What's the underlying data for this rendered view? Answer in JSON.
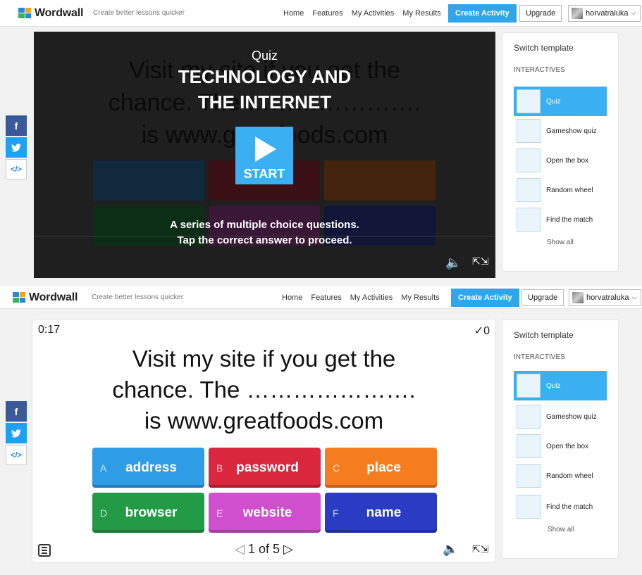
{
  "nav": {
    "logo": "Wordwall",
    "tagline": "Create better lessons quicker",
    "links": [
      "Home",
      "Features",
      "My Activities",
      "My Results"
    ],
    "create": "Create Activity",
    "upgrade": "Upgrade",
    "user": "horvatraluka"
  },
  "share": {
    "facebook": "f",
    "twitter": "t",
    "embed": "</>"
  },
  "panel": {
    "title": "Switch template",
    "section": "INTERACTIVES",
    "templates": [
      "Quiz",
      "Gameshow quiz",
      "Open the box",
      "Random wheel",
      "Find the match"
    ],
    "show_all": "Show all"
  },
  "intro": {
    "subtitle": "Quiz",
    "title_line1": "TECHNOLOGY AND",
    "title_line2": "THE INTERNET",
    "start": "START",
    "desc_line1": "A series of multiple choice questions.",
    "desc_line2": "Tap the correct answer to proceed."
  },
  "game": {
    "timer": "0:17",
    "score": "✓0",
    "question_line1": "Visit my site if you get the",
    "question_line2": "chance. The ………………….",
    "question_line3": "is www.greatfoods.com",
    "answers": [
      {
        "letter": "A",
        "text": "address",
        "color": "#2f9ce6"
      },
      {
        "letter": "B",
        "text": "password",
        "color": "#d9283d"
      },
      {
        "letter": "C",
        "text": "place",
        "color": "#f57c1f"
      },
      {
        "letter": "D",
        "text": "browser",
        "color": "#239a45"
      },
      {
        "letter": "E",
        "text": "website",
        "color": "#cf4fcf"
      },
      {
        "letter": "F",
        "text": "name",
        "color": "#2a3bc4"
      }
    ],
    "pager": "1 of 5"
  },
  "icons": {
    "sound": "sound-icon",
    "fullscreen": "fullscreen-icon",
    "menu": "menu-icon"
  }
}
